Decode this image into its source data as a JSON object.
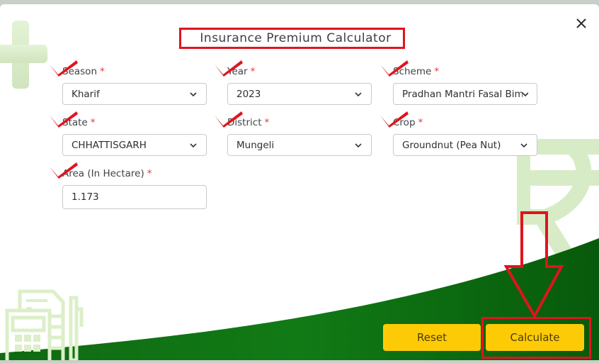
{
  "dialog": {
    "title": "Insurance Premium Calculator",
    "close_icon": "close-icon"
  },
  "fields": {
    "season": {
      "label": "Season",
      "required": "*",
      "value": "Kharif",
      "type": "select"
    },
    "year": {
      "label": "Year",
      "required": "*",
      "value": "2023",
      "type": "select"
    },
    "scheme": {
      "label": "Scheme",
      "required": "*",
      "value": "Pradhan Mantri Fasal Bima Yojana",
      "display_value": "Pradhan Mantri Fasal Bim",
      "type": "select"
    },
    "state": {
      "label": "State",
      "required": "*",
      "value": "CHHATTISGARH",
      "type": "select"
    },
    "district": {
      "label": "District",
      "required": "*",
      "value": "Mungeli",
      "type": "select"
    },
    "crop": {
      "label": "Crop",
      "required": "*",
      "value": "Groundnut (Pea Nut)",
      "type": "select"
    },
    "area": {
      "label": "Area (In Hectare)",
      "required": "*",
      "value": "1.173",
      "type": "text"
    }
  },
  "buttons": {
    "reset": "Reset",
    "calculate": "Calculate"
  },
  "colors": {
    "accent_yellow": "#fccb05",
    "footer_green": "#0b6410",
    "annotation_red": "#e0141e",
    "decor_light_green": "#d6ebc8"
  },
  "annotations": {
    "checkmarks": [
      "season",
      "year",
      "scheme",
      "state",
      "district",
      "crop",
      "area"
    ],
    "highlight_title": true,
    "arrow_to": "calculate"
  }
}
